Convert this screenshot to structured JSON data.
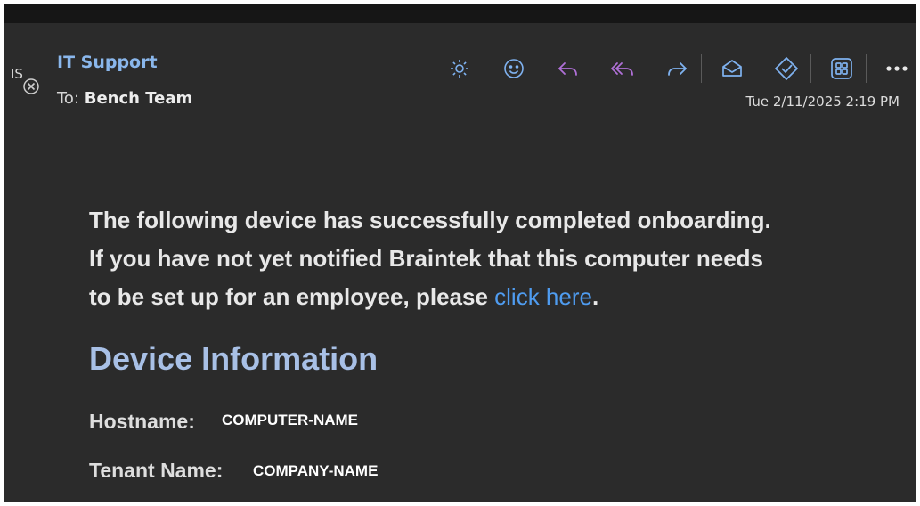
{
  "header": {
    "avatar_initials": "IS",
    "sender": "IT Support",
    "to_prefix": "To:",
    "to_recipient": "Bench Team",
    "date": "Tue 2/11/2025 2:19 PM"
  },
  "toolbar": {
    "icons": [
      "brightness-icon",
      "emoji-icon",
      "reply-icon",
      "reply-all-icon",
      "forward-icon",
      "mark-read-icon",
      "tag-icon",
      "apps-icon",
      "more-icon"
    ]
  },
  "body": {
    "line1": "The following device has successfully completed onboarding.",
    "line2": "If you have not yet notified Braintek that this computer needs",
    "line3_prefix": "to be set up for an employee, please ",
    "link_text": "click here",
    "line3_suffix": ".",
    "heading": "Device Information",
    "hostname_label": "Hostname:",
    "hostname_value": "COMPUTER-NAME",
    "tenant_label": "Tenant Name:",
    "tenant_value": "COMPANY-NAME"
  },
  "colors": {
    "background": "#2b2b2b",
    "accent_blue": "#4f9cf0",
    "sender_blue": "#8ab7ec",
    "heading_blue": "#a8c0e6",
    "reply_purple": "#b070d8"
  }
}
